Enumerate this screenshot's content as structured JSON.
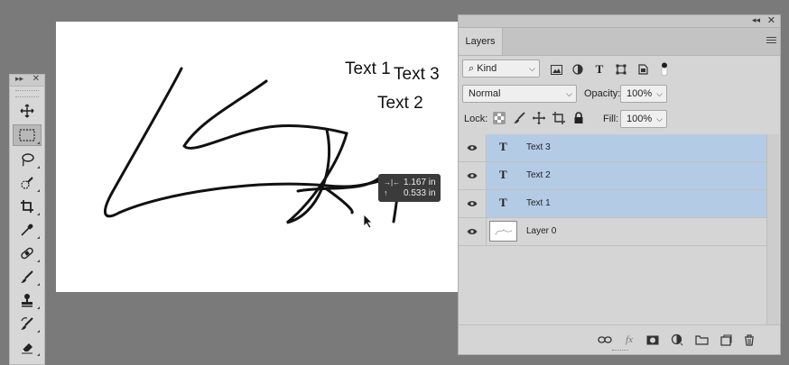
{
  "canvas": {
    "texts": [
      "Text 1",
      "Text 3",
      "Text 2"
    ],
    "measure": {
      "width_label": "→|←",
      "width_value": "1.167 in",
      "height_label": "↑",
      "height_value": "0.533 in"
    }
  },
  "tools": {
    "collapse": "▸▸",
    "close": "✕",
    "items": [
      "move-tool",
      "marquee-tool",
      "lasso-tool",
      "quick-select-tool",
      "crop-tool",
      "eyedropper-tool",
      "healing-brush-tool",
      "brush-tool",
      "clone-stamp-tool",
      "history-brush-tool",
      "eraser-tool"
    ]
  },
  "layers_panel": {
    "collapse": "◂◂",
    "close": "✕",
    "tab": "Layers",
    "filter": {
      "label": "Kind",
      "icon": "⌕"
    },
    "blend_mode": "Normal",
    "opacity_label": "Opacity:",
    "opacity_value": "100%",
    "lock_label": "Lock:",
    "fill_label": "Fill:",
    "fill_value": "100%",
    "layers": [
      {
        "name": "Text 3",
        "type": "text",
        "selected": true
      },
      {
        "name": "Text 2",
        "type": "text",
        "selected": true
      },
      {
        "name": "Text 1",
        "type": "text",
        "selected": true
      },
      {
        "name": "Layer 0",
        "type": "image",
        "selected": false
      }
    ],
    "text_glyph": "T",
    "fx_label": "fx"
  },
  "colors": {
    "selected_layer": "#b4cbe6",
    "panel_bg": "#d5d5d5",
    "workspace_bg": "#7a7a7a"
  }
}
